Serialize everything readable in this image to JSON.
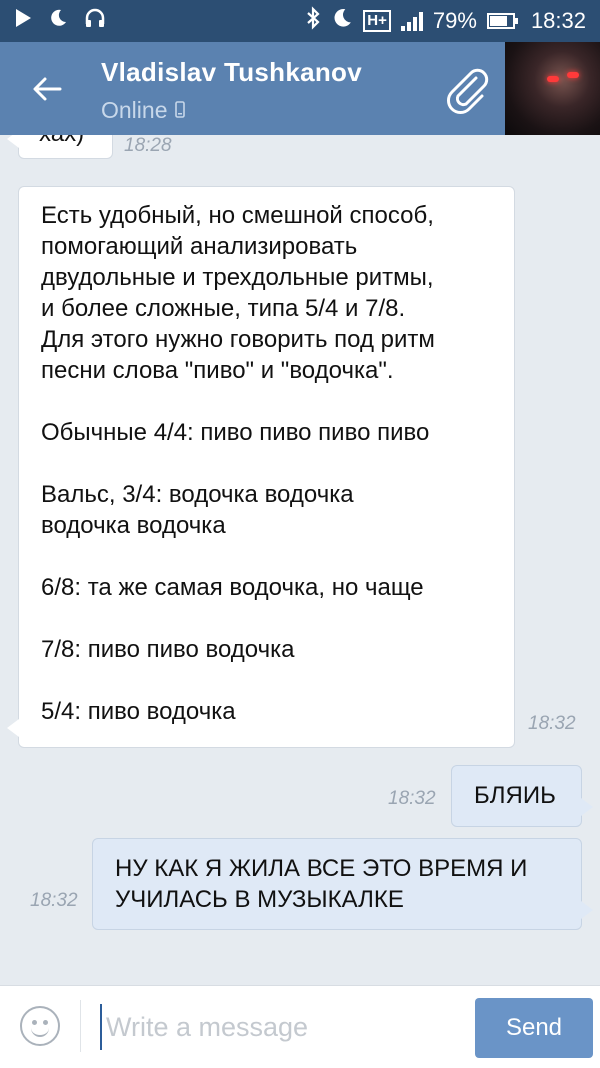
{
  "status_bar": {
    "battery": "79%",
    "battery_level": 0.79,
    "time": "18:32",
    "network_type": "H+",
    "icons": [
      "play-icon",
      "moon-icon",
      "headset-icon",
      "bluetooth-icon",
      "moon-icon",
      "signal-icon",
      "battery-icon"
    ]
  },
  "header": {
    "contact_name": "Vladislav Tushkanov",
    "status": "Online",
    "colors": {
      "header": "#5b82b0",
      "status_bar": "#2c4e73"
    }
  },
  "messages": [
    {
      "direction": "in",
      "lines": [
        "хах)"
      ],
      "time": "18:28"
    },
    {
      "direction": "in",
      "lines": [
        "Есть удобный, но смешной способ,",
        "помогающий анализировать",
        "двудольные и трехдольные ритмы,",
        "и более сложные, типа 5/4 и 7/8.",
        "Для этого нужно говорить под ритм",
        "песни слова \"пиво\" и \"водочка\".",
        "",
        "Обычные 4/4: пиво пиво пиво пиво",
        "",
        "Вальс, 3/4: водочка водочка",
        "водочка водочка",
        "",
        "6/8: та же самая водочка, но чаще",
        "",
        "7/8: пиво пиво водочка",
        "",
        "5/4: пиво водочка"
      ],
      "time": "18:32"
    },
    {
      "direction": "out",
      "lines": [
        "БЛЯИЬ"
      ],
      "time": "18:32"
    },
    {
      "direction": "out",
      "lines": [
        "НУ КАК Я ЖИЛА ВСЕ ЭТО ВРЕМЯ И",
        "УЧИЛАСЬ В МУЗЫКАЛКЕ"
      ],
      "time": "18:32"
    }
  ],
  "composer": {
    "placeholder": "Write a message",
    "value": "",
    "send_label": "Send",
    "colors": {
      "send": "#6a94c7"
    }
  }
}
